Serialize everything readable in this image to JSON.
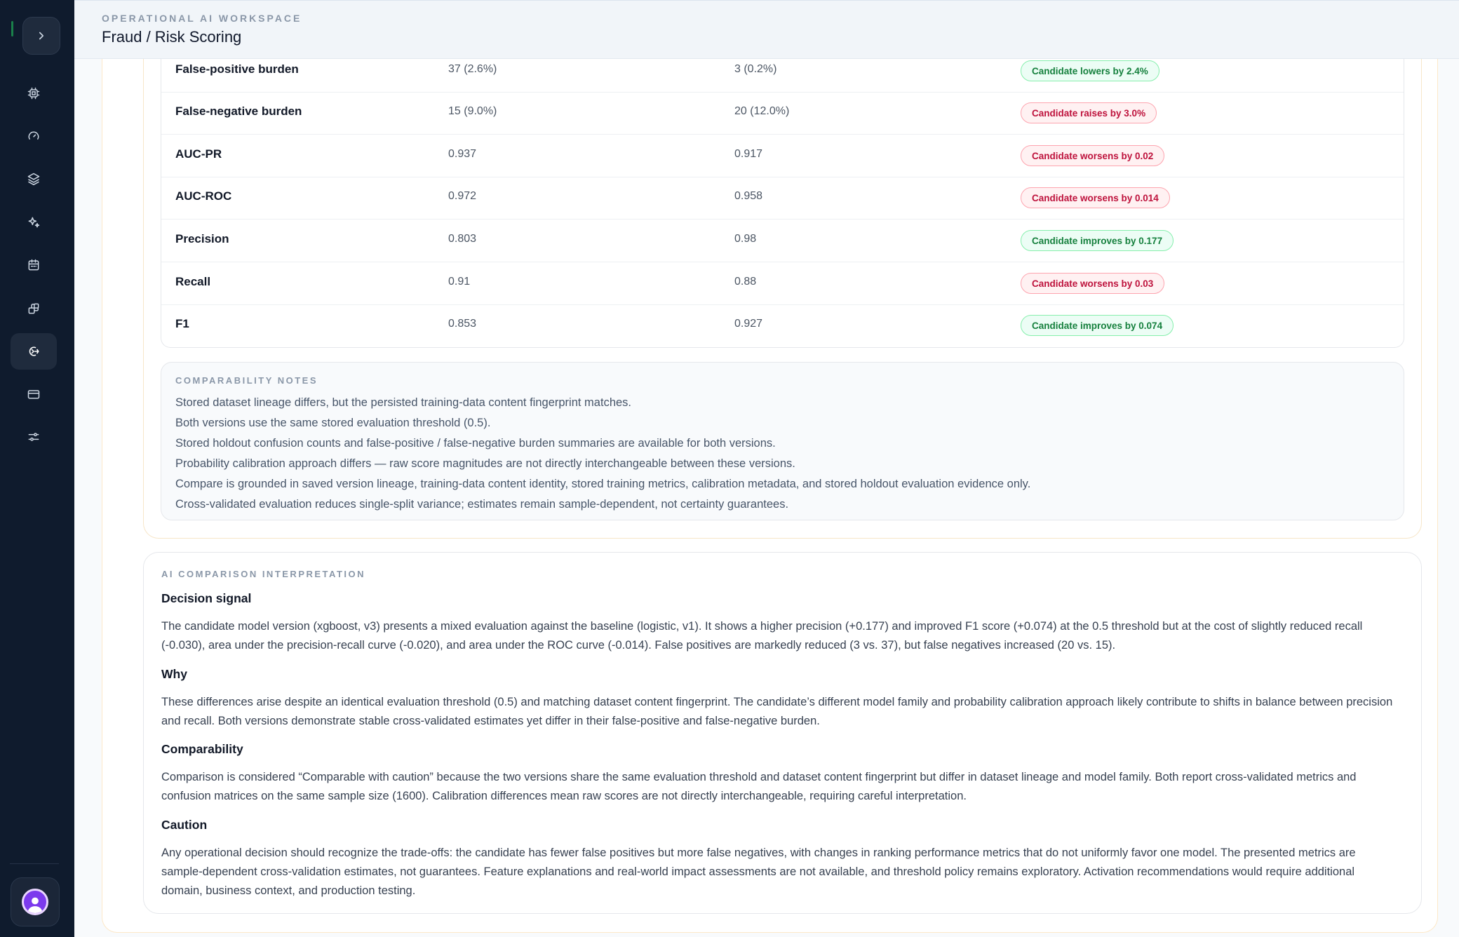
{
  "header": {
    "eyebrow": "OPERATIONAL AI WORKSPACE",
    "title": "Fraud / Risk Scoring"
  },
  "sidebar": {
    "toggle_icon": "chevron-right-icon",
    "items": [
      {
        "icon": "cpu-icon",
        "active": false
      },
      {
        "icon": "gauge-icon",
        "active": false
      },
      {
        "icon": "layers-icon",
        "active": false
      },
      {
        "icon": "sparkles-icon",
        "active": false
      },
      {
        "icon": "calendar-icon",
        "active": false
      },
      {
        "icon": "blocks-icon",
        "active": false
      },
      {
        "icon": "compare-icon",
        "active": true
      },
      {
        "icon": "card-icon",
        "active": false
      },
      {
        "icon": "sliders-icon",
        "active": false
      }
    ],
    "avatar_icon": "user-avatar-icon"
  },
  "metrics": {
    "rows": [
      {
        "metric": "False-positive burden",
        "baseline": "37 (2.6%)",
        "candidate": "3 (0.2%)",
        "verdict": "Candidate lowers by 2.4%",
        "tone": "good"
      },
      {
        "metric": "False-negative burden",
        "baseline": "15 (9.0%)",
        "candidate": "20 (12.0%)",
        "verdict": "Candidate raises by 3.0%",
        "tone": "bad"
      },
      {
        "metric": "AUC-PR",
        "baseline": "0.937",
        "candidate": "0.917",
        "verdict": "Candidate worsens by 0.02",
        "tone": "bad"
      },
      {
        "metric": "AUC-ROC",
        "baseline": "0.972",
        "candidate": "0.958",
        "verdict": "Candidate worsens by 0.014",
        "tone": "bad"
      },
      {
        "metric": "Precision",
        "baseline": "0.803",
        "candidate": "0.98",
        "verdict": "Candidate improves by 0.177",
        "tone": "good"
      },
      {
        "metric": "Recall",
        "baseline": "0.91",
        "candidate": "0.88",
        "verdict": "Candidate worsens by 0.03",
        "tone": "bad"
      },
      {
        "metric": "F1",
        "baseline": "0.853",
        "candidate": "0.927",
        "verdict": "Candidate improves by 0.074",
        "tone": "good"
      }
    ]
  },
  "notes": {
    "label": "COMPARABILITY NOTES",
    "items": [
      "Stored dataset lineage differs, but the persisted training-data content fingerprint matches.",
      "Both versions use the same stored evaluation threshold (0.5).",
      "Stored holdout confusion counts and false-positive / false-negative burden summaries are available for both versions.",
      "Probability calibration approach differs — raw score magnitudes are not directly interchangeable between these versions.",
      "Compare is grounded in saved version lineage, training-data content identity, stored training metrics, calibration metadata, and stored holdout evaluation evidence only.",
      "Cross-validated evaluation reduces single-split variance; estimates remain sample-dependent, not certainty guarantees."
    ]
  },
  "ai": {
    "label": "AI COMPARISON INTERPRETATION",
    "sections": [
      {
        "title": "Decision signal",
        "body": "The candidate model version (xgboost, v3) presents a mixed evaluation against the baseline (logistic, v1). It shows a higher precision (+0.177) and improved F1 score (+0.074) at the 0.5 threshold but at the cost of slightly reduced recall (-0.030), area under the precision-recall curve (-0.020), and area under the ROC curve (-0.014). False positives are markedly reduced (3 vs. 37), but false negatives increased (20 vs. 15)."
      },
      {
        "title": "Why",
        "body": "These differences arise despite an identical evaluation threshold (0.5) and matching dataset content fingerprint. The candidate’s different model family and probability calibration approach likely contribute to shifts in balance between precision and recall. Both versions demonstrate stable cross-validated estimates yet differ in their false-positive and false-negative burden."
      },
      {
        "title": "Comparability",
        "body": "Comparison is considered “Comparable with caution” because the two versions share the same evaluation threshold and dataset content fingerprint but differ in dataset lineage and model family. Both report cross-validated metrics and confusion matrices on the same sample size (1600). Calibration differences mean raw scores are not directly interchangeable, requiring careful interpretation."
      },
      {
        "title": "Caution",
        "body": "Any operational decision should recognize the trade-offs: the candidate has fewer false positives but more false negatives, with changes in ranking performance metrics that do not uniformly favor one model. The presented metrics are sample-dependent cross-validation estimates, not guarantees. Feature explanations and real-world impact assessments are not available, and threshold policy remains exploratory. Activation recommendations would require additional domain, business context, and production testing."
      }
    ]
  }
}
